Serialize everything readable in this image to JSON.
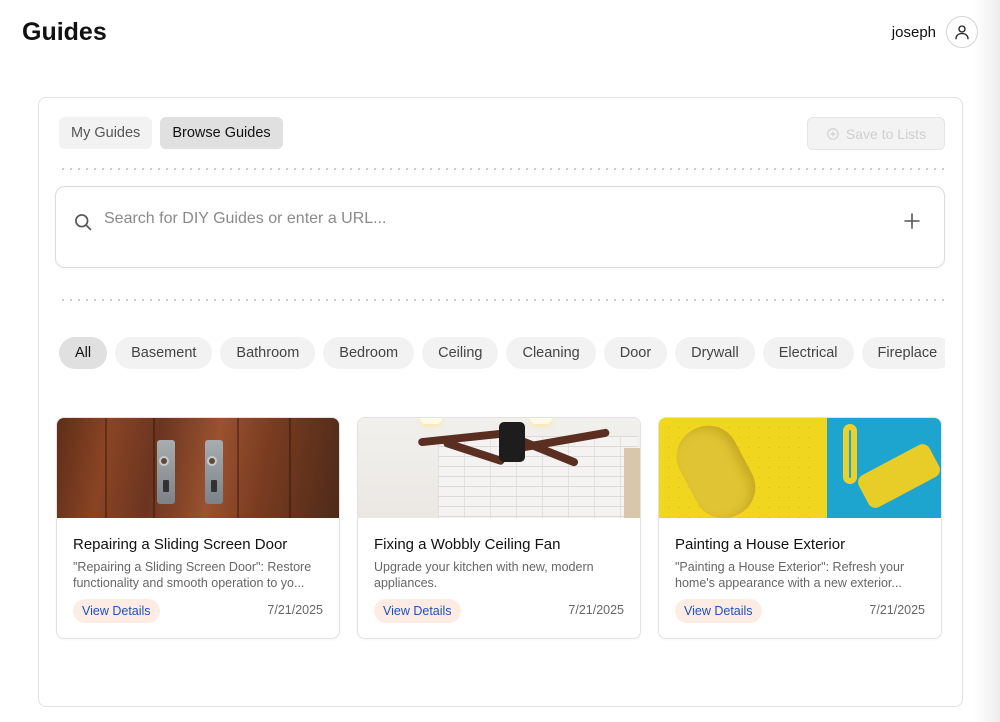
{
  "header": {
    "title": "Guides",
    "username": "joseph"
  },
  "tabs": [
    {
      "label": "My Guides",
      "active": false
    },
    {
      "label": "Browse Guides",
      "active": true
    }
  ],
  "save_button": {
    "label": "Save to Lists",
    "disabled": true
  },
  "search": {
    "placeholder": "Search for DIY Guides or enter a URL...",
    "value": ""
  },
  "categories": [
    {
      "label": "All",
      "active": true
    },
    {
      "label": "Basement"
    },
    {
      "label": "Bathroom"
    },
    {
      "label": "Bedroom"
    },
    {
      "label": "Ceiling"
    },
    {
      "label": "Cleaning"
    },
    {
      "label": "Door"
    },
    {
      "label": "Drywall"
    },
    {
      "label": "Electrical"
    },
    {
      "label": "Fireplace"
    }
  ],
  "guides": [
    {
      "title": "Repairing a Sliding Screen Door",
      "description": "\"Repairing a Sliding Screen Door\": Restore functionality and smooth operation to yo...",
      "button": "View Details",
      "date": "7/21/2025"
    },
    {
      "title": "Fixing a Wobbly Ceiling Fan",
      "description": "Upgrade your kitchen with new, modern appliances.",
      "button": "View Details",
      "date": "7/21/2025"
    },
    {
      "title": "Painting a House Exterior",
      "description": "\"Painting a House Exterior\": Refresh your home's appearance with a new exterior...",
      "button": "View Details",
      "date": "7/21/2025"
    }
  ],
  "colors": {
    "view_button_bg": "#fdece3",
    "view_button_text": "#1f4fbf",
    "chip_active_bg": "#e0e0e0"
  }
}
